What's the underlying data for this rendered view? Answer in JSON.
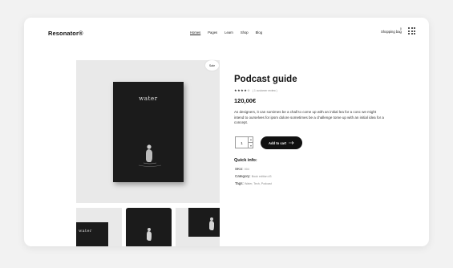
{
  "header": {
    "brand": "Resonator®",
    "nav": [
      "Homes",
      "Pages",
      "Learn",
      "Shop",
      "Blog"
    ],
    "cart_label": "Shopping bag",
    "cart_count": "0",
    "menu_icon": "grid-menu-icon"
  },
  "gallery": {
    "sale_badge": "Sale",
    "book_title": "water",
    "thumb_title": "water"
  },
  "product": {
    "title": "Podcast guide",
    "rating": 4,
    "review_link": "( 1 customer review )",
    "price": "120,00€",
    "description": "As designers, it can somimes be a chall to come up with an initial lea for a conc we might intend to ourselves for ipsm dolore sometimes be a challenge tome up with an initial idea for a concept.",
    "quantity": "1",
    "add_to_cart": "Add to cart",
    "quick_info_title": "Quick info:",
    "sku_label": "SKU:",
    "sku_value": "004",
    "category_label": "Category:",
    "category_value": "Book edition #3",
    "tags_label": "Tags:",
    "tags_value": "Water, Tech, Podcast"
  },
  "colors": {
    "accent": "#111111",
    "background": "#f2f2f2",
    "image_bg": "#e9e9e9"
  }
}
